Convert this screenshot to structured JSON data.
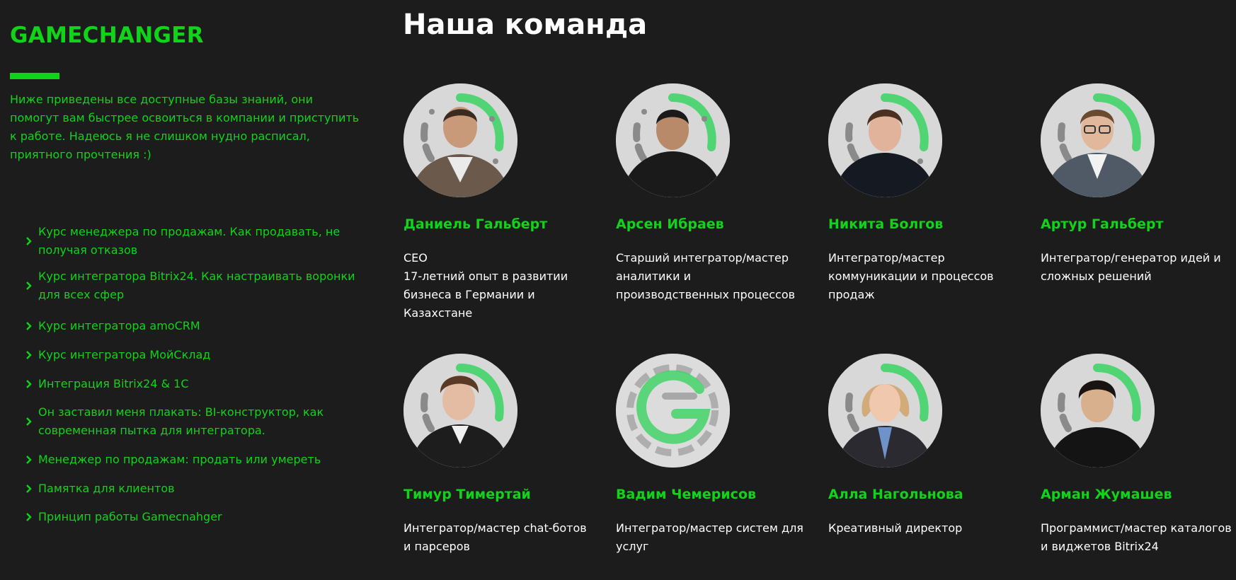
{
  "colors": {
    "background": "#1c1c1c",
    "accent": "#11d41a",
    "text": "#ffffff"
  },
  "sidebar": {
    "logo": "GAMECHANGER",
    "intro": "Ниже приведены все доступные базы знаний, они помогут вам быстрее освоиться в компании и приступить к работе. Надеюсь я не слишком нудно расписал, приятного прочтения :)",
    "items": [
      {
        "label": "Курс менеджера по продажам. Как продавать, не получая отказов",
        "icon": "chevron-right-icon"
      },
      {
        "label": "Курс интегратора Bitrix24. Как настраивать воронки для всех сфер",
        "icon": "chevron-right-icon"
      },
      {
        "label": "Курс интегратора amoCRM",
        "icon": "chevron-right-icon"
      },
      {
        "label": "Курс интегратора МойСклад",
        "icon": "chevron-right-icon"
      },
      {
        "label": "Интеграция Bitrix24 & 1С",
        "icon": "chevron-right-icon"
      },
      {
        "label": "Он заставил меня плакать: BI-конструктор, как современная пытка для интегратора.",
        "icon": "chevron-right-icon"
      },
      {
        "label": "Менеджер по продажам: продать или умереть",
        "icon": "chevron-right-icon"
      },
      {
        "label": "Памятка для клиентов",
        "icon": "chevron-right-icon"
      },
      {
        "label": "Принцип работы Gamecnahger",
        "icon": "chevron-right-icon"
      }
    ]
  },
  "team": {
    "title": "Наша команда",
    "members": [
      {
        "name": "Даниель Гальберт",
        "role": "CEO\n17-летний опыт в развитии бизнеса в Германии и Казахстане",
        "photo": "member-photo"
      },
      {
        "name": "Арсен Ибраев",
        "role": "Старший интегратор/мастер аналитики и производственных процессов",
        "photo": "member-photo"
      },
      {
        "name": "Никита Болгов",
        "role": "Интегратор/мастер коммуникации и процессов продаж",
        "photo": "member-photo"
      },
      {
        "name": "Артур Гальберт",
        "role": "Интегратор/генератор идей и сложных решений",
        "photo": "member-photo"
      },
      {
        "name": "Тимур Тимертай",
        "role": "Интегратор/мастер chat-ботов и парсеров",
        "photo": "member-photo"
      },
      {
        "name": "Вадим Чемерисов",
        "role": "Интегратор/мастер систем для услуг",
        "photo": "logo-placeholder"
      },
      {
        "name": "Алла Нагольнова",
        "role": "Креативный директор",
        "photo": "member-photo"
      },
      {
        "name": "Арман Жумашев",
        "role": "Программист/мастер каталогов и виджетов Bitrix24",
        "photo": "member-photo"
      }
    ]
  }
}
